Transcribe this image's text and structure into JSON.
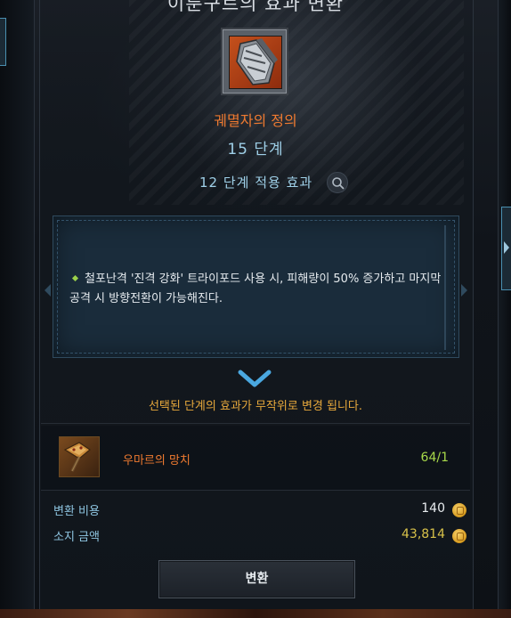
{
  "window": {
    "title": "이룬구트의 효과 변환"
  },
  "item": {
    "name": "궤멸자의 정의",
    "stage": "15 단계",
    "applied_stage_label": "12 단계 적용 효과",
    "icon": "gauntlet-icon"
  },
  "effect": {
    "text": "철포난격 '진격 강화' 트라이포드 사용 시, 피해량이 50% 증가하고 마지막 공격 시 방향전환이 가능해진다."
  },
  "random_note": "선택된 단계의 효과가 무작위로 변경 됩니다.",
  "material": {
    "name": "우마르의 망치",
    "count": "64/1",
    "icon": "hammer-icon"
  },
  "cost": {
    "convert_label": "변환 비용",
    "convert_value": "140",
    "owned_label": "소지 금액",
    "owned_value": "43,814",
    "owned_color": "#d8c24a"
  },
  "button": {
    "convert": "변환"
  },
  "colors": {
    "accent_orange": "#ef7a30",
    "accent_blue": "#9fd0e8",
    "count_green": "#a8d94a"
  }
}
